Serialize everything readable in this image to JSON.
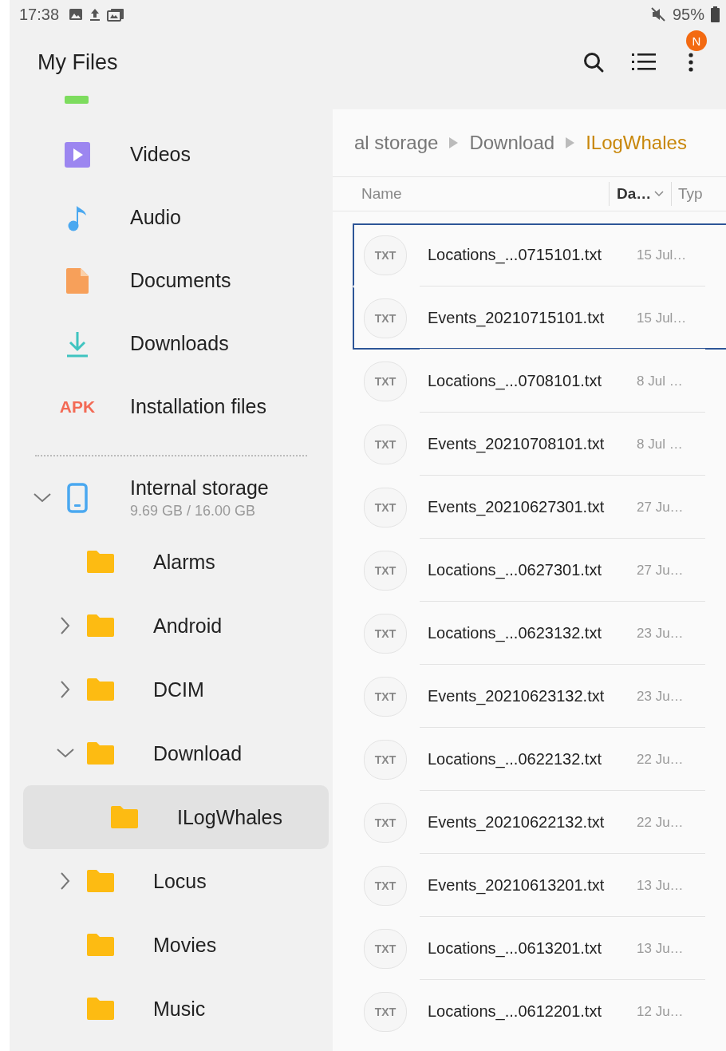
{
  "status_bar": {
    "time": "17:38",
    "battery": "95%"
  },
  "app_bar": {
    "title": "My Files",
    "badge": "N"
  },
  "categories": [
    {
      "label": "Videos",
      "kind": "video"
    },
    {
      "label": "Audio",
      "kind": "audio"
    },
    {
      "label": "Documents",
      "kind": "document"
    },
    {
      "label": "Downloads",
      "kind": "download"
    },
    {
      "label": "Installation files",
      "kind": "apk",
      "icon_text": "APK"
    }
  ],
  "storage": {
    "name": "Internal storage",
    "usage": "9.69 GB / 16.00 GB",
    "expanded": true,
    "children": [
      {
        "label": "Alarms",
        "selected": false
      },
      {
        "label": "Android",
        "expanded": false,
        "selected": false
      },
      {
        "label": "DCIM",
        "expanded": false,
        "selected": false
      },
      {
        "label": "Download",
        "expanded": true,
        "selected": false,
        "children": [
          {
            "label": "ILogWhales",
            "selected": true
          }
        ]
      },
      {
        "label": "Locus",
        "expanded": false,
        "selected": false
      },
      {
        "label": "Movies",
        "selected": false
      },
      {
        "label": "Music",
        "selected": false
      }
    ]
  },
  "breadcrumb": [
    {
      "label": "al storage",
      "selected": false
    },
    {
      "label": "Download",
      "selected": false
    },
    {
      "label": "ILogWhales",
      "selected": true
    }
  ],
  "columns": [
    {
      "label": "Name",
      "sorted": false
    },
    {
      "label": "Da…",
      "sorted": true
    },
    {
      "label": "Typ",
      "sorted": false
    }
  ],
  "files": [
    {
      "icon_text": "TXT",
      "name": "Locations_...0715101.txt",
      "date": "15 Jul…",
      "selected": true
    },
    {
      "icon_text": "TXT",
      "name": "Events_20210715101.txt",
      "date": "15 Jul…",
      "selected": true
    },
    {
      "icon_text": "TXT",
      "name": "Locations_...0708101.txt",
      "date": "8 Jul …",
      "selected": false
    },
    {
      "icon_text": "TXT",
      "name": "Events_20210708101.txt",
      "date": "8 Jul …",
      "selected": false
    },
    {
      "icon_text": "TXT",
      "name": "Events_20210627301.txt",
      "date": "27 Ju…",
      "selected": false
    },
    {
      "icon_text": "TXT",
      "name": "Locations_...0627301.txt",
      "date": "27 Ju…",
      "selected": false
    },
    {
      "icon_text": "TXT",
      "name": "Locations_...0623132.txt",
      "date": "23 Ju…",
      "selected": false
    },
    {
      "icon_text": "TXT",
      "name": "Events_20210623132.txt",
      "date": "23 Ju…",
      "selected": false
    },
    {
      "icon_text": "TXT",
      "name": "Locations_...0622132.txt",
      "date": "22 Ju…",
      "selected": false
    },
    {
      "icon_text": "TXT",
      "name": "Events_20210622132.txt",
      "date": "22 Ju…",
      "selected": false
    },
    {
      "icon_text": "TXT",
      "name": "Events_20210613201.txt",
      "date": "13 Ju…",
      "selected": false
    },
    {
      "icon_text": "TXT",
      "name": "Locations_...0613201.txt",
      "date": "13 Ju…",
      "selected": false
    },
    {
      "icon_text": "TXT",
      "name": "Locations_...0612201.txt",
      "date": "12 Ju…",
      "selected": false
    }
  ]
}
